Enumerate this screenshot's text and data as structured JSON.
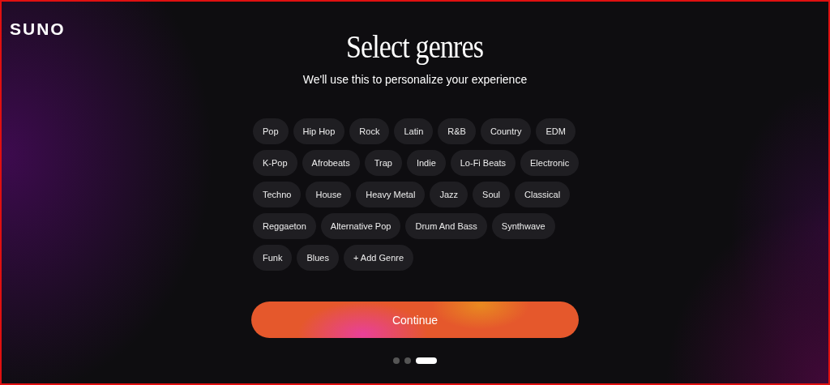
{
  "logo": "SUNO",
  "title": "Select genres",
  "subtitle": "We'll use this to personalize your experience",
  "genre_rows": [
    [
      {
        "label": "Pop",
        "selected": false
      },
      {
        "label": "Hip Hop",
        "selected": false
      },
      {
        "label": "Rock",
        "selected": false
      },
      {
        "label": "Latin",
        "selected": false
      },
      {
        "label": "R&B",
        "selected": false
      },
      {
        "label": "Country",
        "selected": false
      },
      {
        "label": "EDM",
        "selected": false
      }
    ],
    [
      {
        "label": "K-Pop",
        "selected": false
      },
      {
        "label": "Afrobeats",
        "selected": false
      },
      {
        "label": "Trap",
        "selected": false
      },
      {
        "label": "Indie",
        "selected": false
      },
      {
        "label": "Lo-Fi Beats",
        "selected": false
      },
      {
        "label": "Electronic",
        "selected": false
      }
    ],
    [
      {
        "label": "Techno",
        "selected": false
      },
      {
        "label": "House",
        "selected": false
      },
      {
        "label": "Heavy Metal",
        "selected": false
      },
      {
        "label": "Jazz",
        "selected": false
      },
      {
        "label": "Soul",
        "selected": false
      },
      {
        "label": "Classical",
        "selected": false
      }
    ],
    [
      {
        "label": "Reggaeton",
        "selected": false
      },
      {
        "label": "Alternative Pop",
        "selected": false
      },
      {
        "label": "Drum And Bass",
        "selected": false
      },
      {
        "label": "Synthwave",
        "selected": false
      }
    ],
    [
      {
        "label": "Funk",
        "selected": false
      },
      {
        "label": "Blues",
        "selected": false
      },
      {
        "label": "+ Add Genre",
        "selected": false
      }
    ]
  ],
  "continue_button": "Continue",
  "steps": [
    {
      "selected": false
    },
    {
      "selected": false
    },
    {
      "selected": true
    }
  ]
}
